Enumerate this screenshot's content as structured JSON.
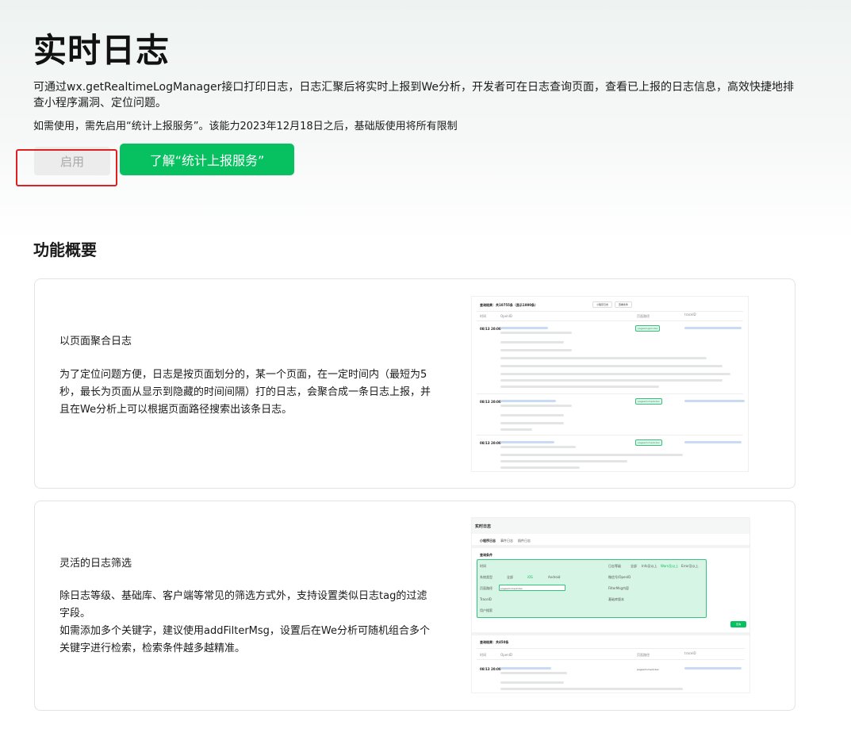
{
  "hero": {
    "title": "实时日志",
    "description": "可通过wx.getRealtimeLogManager接口打印日志，日志汇聚后将实时上报到We分析，开发者可在日志查询页面，查看已上报的日志信息，高效快捷地排查小程序漏洞、定位问题。",
    "note": "如需使用，需先启用“统计上报服务”。该能力2023年12月18日之后，基础版使用将所有限制",
    "enable_button": "启用",
    "learn_button": "了解“统计上报服务”"
  },
  "overview": {
    "title": "功能概要",
    "cards": [
      {
        "heading": "以页面聚合日志",
        "body": "为了定位问题方便，日志是按页面划分的，某一个页面，在一定时间内（最短为5秒，最长为页面从显示到隐藏的时间间隔）打的日志，会聚合成一条日志上报，并且在We分析上可以根据页面路径搜索出该条日志。",
        "screenshot": {
          "result_label": "查询结果：共10755条（显示1000条）",
          "btn_a": "小程序日志",
          "btn_b": "查看条件",
          "col_time": "时间",
          "col_openid": "OpenID",
          "col_page": "页面路径",
          "col_traceid": "traceID",
          "rows": [
            {
              "time": "08/13 20:00",
              "page": "pages/logs/index"
            },
            {
              "time": "08/13 20:00",
              "page": "pages/home/index"
            },
            {
              "time": "08/13 20:00",
              "page": "pages/home/index"
            }
          ]
        }
      },
      {
        "heading": "灵活的日志筛选",
        "body_lines": [
          "除日志等级、基础库、客户端等常见的筛选方式外，支持设置类似日志tag的过滤字段。",
          "如需添加多个关键字，建议使用addFilterMsg，设置后在We分析可随机组合多个关键字进行检索，检索条件越多越精准。"
        ],
        "screenshot": {
          "title": "实时日志",
          "tabs": [
            "小程序日志",
            "事件日志",
            "插件日志"
          ],
          "query_label": "查询条件",
          "filter_time": "时间",
          "filter_system": "系统类型",
          "filter_page": "页面路径",
          "filter_traceid": "TraceID",
          "filter_user": "用户搜索",
          "filter_loglevel": "日志等级",
          "filter_openid": "微信号/OpenID",
          "filter_filtermsg": "FilterMsg内容",
          "filter_base": "基础库版本",
          "page_value": "pages/home/index",
          "sys_all": "全部",
          "sys_ios": "iOS",
          "sys_android": "Android",
          "level_all": "全部",
          "level_info": "Info及以上",
          "level_warn": "Warn及以上",
          "level_error": "Error及以上",
          "search_btn": "查询",
          "result_label": "查询结果：共450条",
          "col_time": "时间",
          "col_openid": "OpenID",
          "col_page": "页面路径",
          "col_traceid": "traceID",
          "row_time": "08/13 20:00",
          "row_page": "pages/home/index"
        }
      }
    ]
  }
}
